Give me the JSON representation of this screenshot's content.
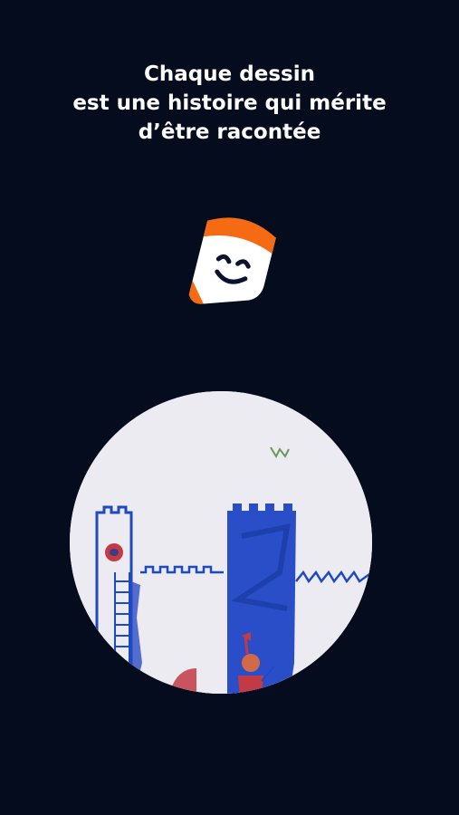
{
  "headline": {
    "line1": "Chaque dessin",
    "line2": "est une histoire qui mérite",
    "line3": "d’être racontée"
  },
  "logo": {
    "icon": "smiling-pencil-icon",
    "color_accent": "#f46b14",
    "color_body": "#ffffff",
    "color_face": "#0b1230"
  },
  "drawing": {
    "icon": "child-castle-drawing",
    "color_ink": "#1f49c0",
    "color_paper": "#eeeef4"
  },
  "colors": {
    "background": "#040c1e",
    "text": "#ffffff"
  }
}
